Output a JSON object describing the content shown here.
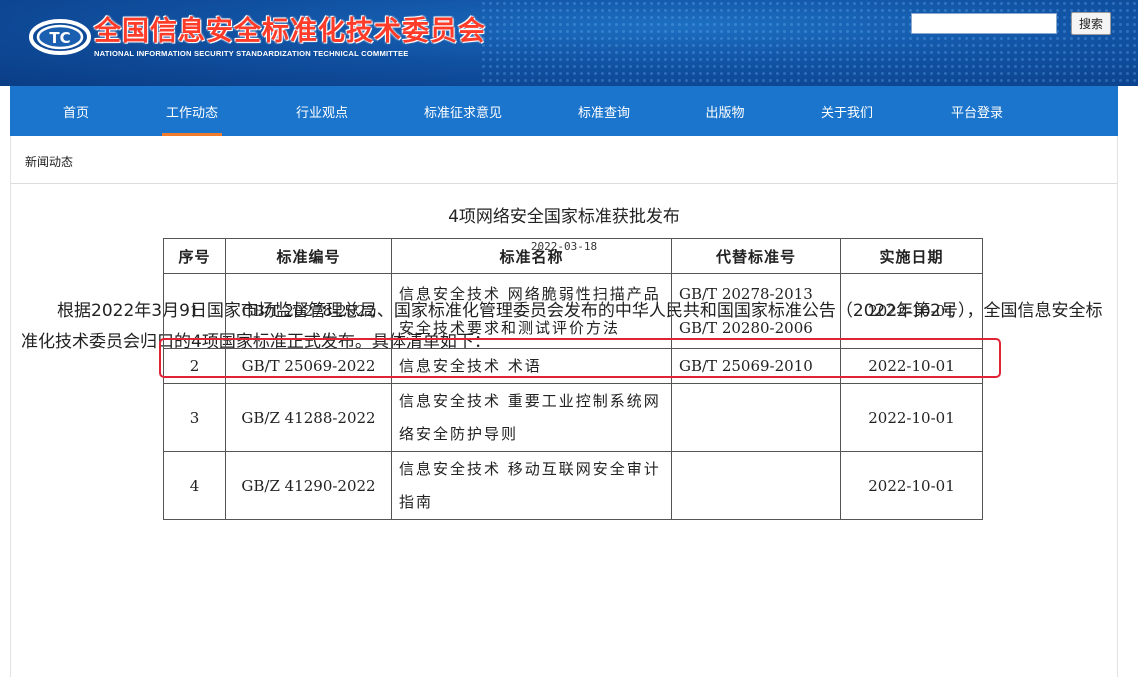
{
  "header": {
    "logo_mark_text": "TC",
    "site_title_cn": "全国信息安全标准化技术委员会",
    "site_title_en": "NATIONAL INFORMATION SECURITY STANDARDIZATION TECHNICAL COMMITTEE",
    "search_placeholder": "",
    "search_button": "搜索"
  },
  "nav": {
    "items": [
      {
        "label": "首页"
      },
      {
        "label": "工作动态"
      },
      {
        "label": "行业观点"
      },
      {
        "label": "标准征求意见"
      },
      {
        "label": "标准查询"
      },
      {
        "label": "出版物"
      },
      {
        "label": "关于我们"
      },
      {
        "label": "平台登录"
      }
    ],
    "active_index": 1,
    "active_indicator_color": "#f07c2a",
    "bar_color": "#1c75cc"
  },
  "breadcrumb": "新闻动态",
  "article": {
    "title": "4项网络安全国家标准获批发布",
    "date": "2022-03-18",
    "body": "根据2022年3月9日国家市场监督管理总局、国家标准化管理委员会发布的中华人民共和国国家标准公告（2022年第2号），全国信息安全标准化技术委员会归口的4项国家标准正式发布。具体清单如下："
  },
  "table": {
    "headers": {
      "num": "序号",
      "code": "标准编号",
      "name": "标准名称",
      "replaces": "代替标准号",
      "date": "实施日期"
    },
    "rows": [
      {
        "num": "1",
        "code": "GB/T 20278-2022",
        "name": "信息安全技术 网络脆弱性扫描产品安全技术要求和测试评价方法",
        "replaces_1": "GB/T 20278-2013",
        "replaces_2": "GB/T 20280-2006",
        "date": "2022-10-01"
      },
      {
        "num": "2",
        "code": "GB/T 25069-2022",
        "name": "信息安全技术 术语",
        "replaces_1": "GB/T 25069-2010",
        "date": "2022-10-01"
      },
      {
        "num": "3",
        "code": "GB/Z 41288-2022",
        "name": "信息安全技术 重要工业控制系统网络安全防护导则",
        "date": "2022-10-01"
      },
      {
        "num": "4",
        "code": "GB/Z 41290-2022",
        "name": "信息安全技术 移动互联网安全审计指南",
        "date": "2022-10-01"
      }
    ],
    "highlighted_row": 2,
    "highlight_color": "#e02435"
  }
}
